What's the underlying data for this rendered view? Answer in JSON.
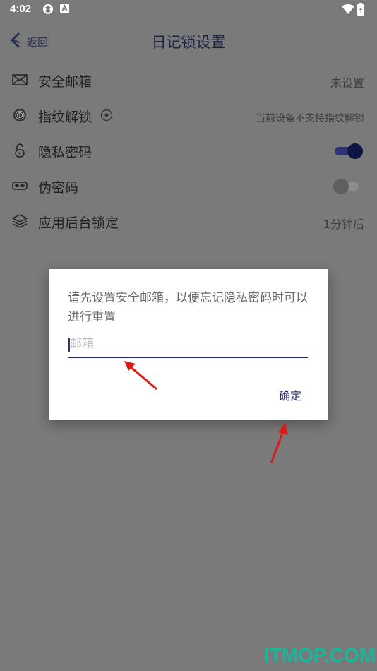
{
  "status_bar": {
    "time": "4:02"
  },
  "header": {
    "back_label": "返回",
    "title": "日记锁设置"
  },
  "rows": [
    {
      "icon": "envelope-icon",
      "label": "安全邮箱",
      "value": "未设置"
    },
    {
      "icon": "fingerprint-icon",
      "label": "指纹解锁",
      "value": "当前设备不支持指纹解锁"
    },
    {
      "icon": "lock-icon",
      "label": "隐私密码",
      "toggle": true
    },
    {
      "icon": "mask-icon",
      "label": "伪密码",
      "toggle": false
    },
    {
      "icon": "layers-icon",
      "label": "应用后台锁定",
      "value": "1分钟后"
    }
  ],
  "dialog": {
    "message": "请先设置安全邮箱，以便忘记隐私密码时可以进行重置",
    "email_placeholder": "邮箱",
    "confirm_label": "确定"
  },
  "watermark": "ITMOP.COM",
  "colors": {
    "accent": "#1e2460",
    "overlay": "#7a7a7a",
    "watermark": "#15b89a",
    "arrow": "#d81c1c"
  }
}
